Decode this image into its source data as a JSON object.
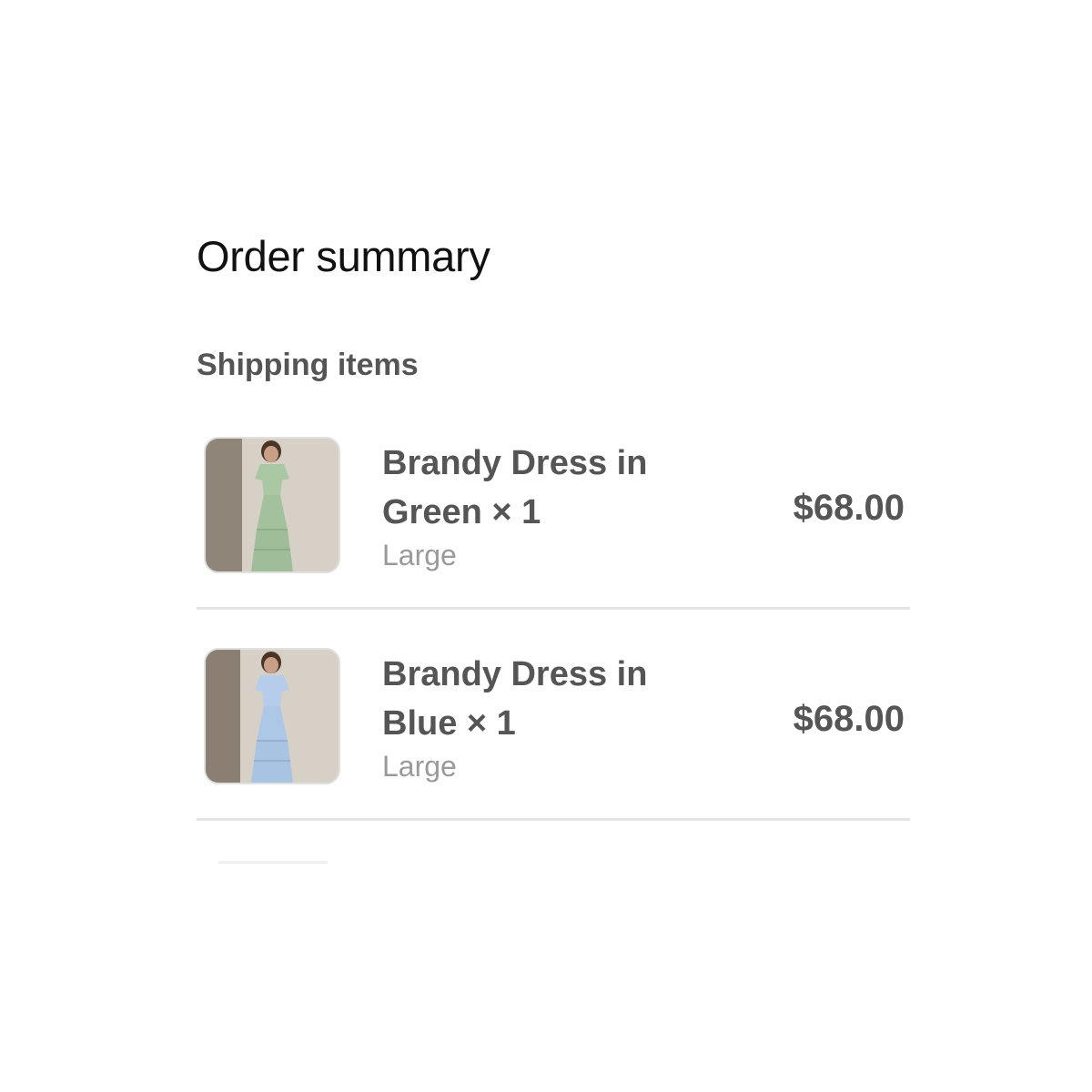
{
  "order_summary": {
    "title": "Order summary",
    "section_label": "Shipping items",
    "items": [
      {
        "name_line1": "Brandy Dress in",
        "name_line2": "Green × 1",
        "variant": "Large",
        "price": "$68.00",
        "dress_color": "#a9c7a2"
      },
      {
        "name_line1": "Brandy Dress in",
        "name_line2": "Blue × 1",
        "variant": "Large",
        "price": "$68.00",
        "dress_color": "#b5cdea"
      }
    ]
  }
}
